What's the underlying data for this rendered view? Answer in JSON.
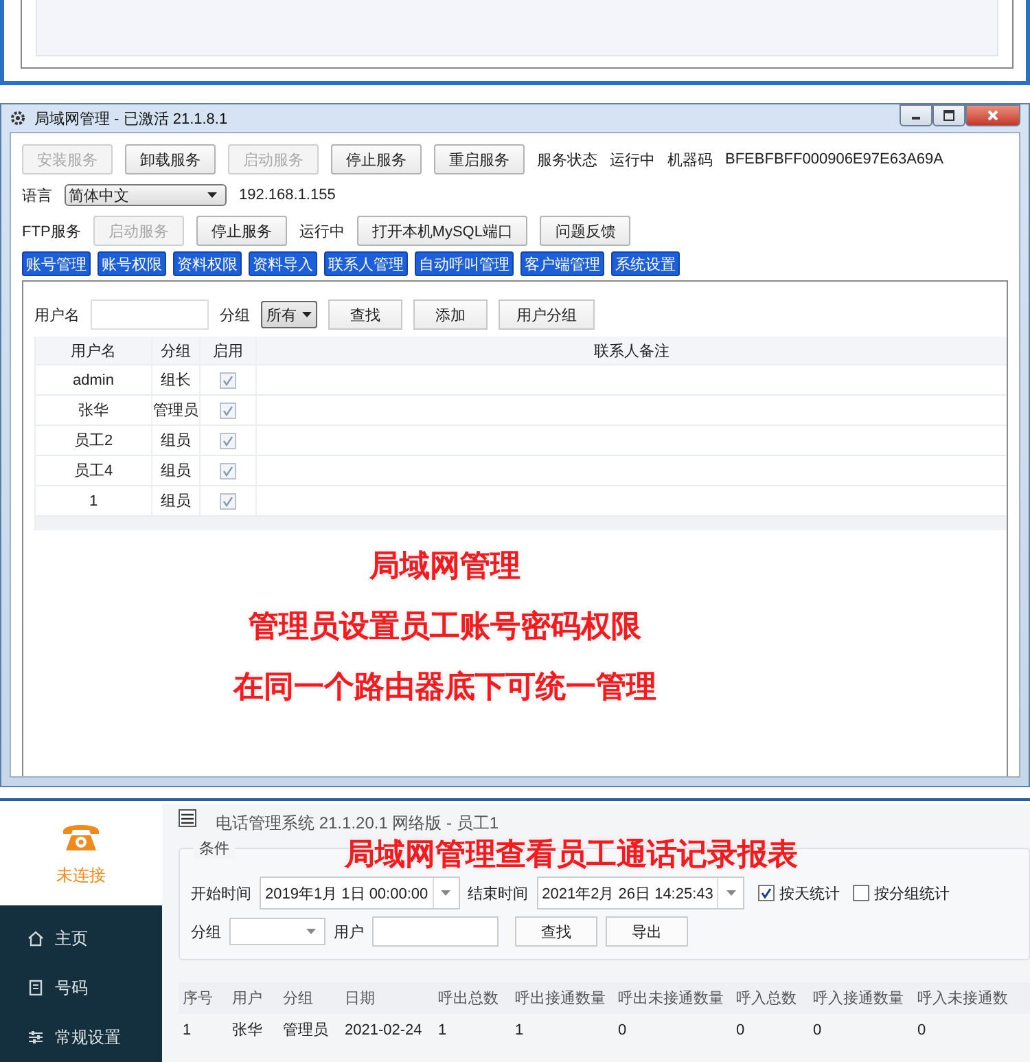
{
  "lan_window": {
    "title": "局域网管理 - 已激活  21.1.8.1",
    "service_row": [
      {
        "kind": "button",
        "label": "安装服务",
        "disabled": true
      },
      {
        "kind": "button",
        "label": "卸载服务",
        "disabled": false
      },
      {
        "kind": "button",
        "label": "启动服务",
        "disabled": true
      },
      {
        "kind": "button",
        "label": "停止服务",
        "disabled": false
      },
      {
        "kind": "button",
        "label": "重启服务",
        "disabled": false
      },
      {
        "kind": "text",
        "label": "服务状态"
      },
      {
        "kind": "text",
        "label": "运行中"
      },
      {
        "kind": "text",
        "label": "机器码"
      },
      {
        "kind": "text",
        "label": "BFEBFBFF000906E97E63A69A"
      }
    ],
    "language_label": "语言",
    "language": "简体中文",
    "ip": "192.168.1.155",
    "ftp_row": [
      {
        "kind": "text",
        "label": "FTP服务"
      },
      {
        "kind": "button",
        "label": "启动服务",
        "disabled": true
      },
      {
        "kind": "button",
        "label": "停止服务",
        "disabled": false
      },
      {
        "kind": "text",
        "label": "运行中"
      },
      {
        "kind": "button",
        "label": "打开本机MySQL端口",
        "disabled": false
      },
      {
        "kind": "button",
        "label": "问题反馈",
        "disabled": false
      }
    ],
    "tabs": [
      "账号管理",
      "账号权限",
      "资料权限",
      "资料导入",
      "联系人管理",
      "自动呼叫管理",
      "客户端管理",
      "系统设置"
    ],
    "filter": {
      "username_label": "用户名",
      "group_label": "分组",
      "group": "所有",
      "buttons": [
        "查找",
        "添加",
        "用户分组"
      ]
    },
    "table": {
      "columns": [
        "用户名",
        "分组",
        "启用",
        "联系人备注"
      ],
      "rows": [
        {
          "user": "admin",
          "group": "组长",
          "enabled": true
        },
        {
          "user": "张华",
          "group": "管理员",
          "enabled": true
        },
        {
          "user": "员工2",
          "group": "组员",
          "enabled": true
        },
        {
          "user": "员工4",
          "group": "组员",
          "enabled": true
        },
        {
          "user": "1",
          "group": "组员",
          "enabled": true
        }
      ]
    },
    "captions": [
      "局域网管理",
      "管理员设置员工账号密码权限",
      "在同一个路由器底下可统一管理"
    ]
  },
  "phone_app": {
    "title": "电话管理系统  21.1.20.1  网络版 - 员工1",
    "connection": "未连接",
    "nav": [
      {
        "kind": "home",
        "label": "主页"
      },
      {
        "kind": "document",
        "label": "号码"
      },
      {
        "kind": "sliders",
        "label": "常规设置"
      }
    ],
    "caption": "局域网管理查看员工通话记录报表",
    "conditions": {
      "legend": "条件",
      "start_label": "开始时间",
      "start": "2019年1月 1日 00:00:00",
      "end_label": "结束时间",
      "end": "2021年2月 26日 14:25:43",
      "checks": [
        {
          "label": "按天统计",
          "checked": true
        },
        {
          "label": "按分组统计",
          "checked": false
        }
      ],
      "group_label": "分组",
      "user_label": "用户",
      "buttons": [
        "查找",
        "导出"
      ]
    },
    "report": {
      "columns": [
        "序号",
        "用户",
        "分组",
        "日期",
        "呼出总数",
        "呼出接通数量",
        "呼出未接通数量",
        "呼入总数",
        "呼入接通数量",
        "呼入未接通数"
      ],
      "rows": [
        [
          "1",
          "张华",
          "管理员",
          "2021-02-24",
          "1",
          "1",
          "0",
          "0",
          "0",
          "0"
        ]
      ]
    }
  }
}
